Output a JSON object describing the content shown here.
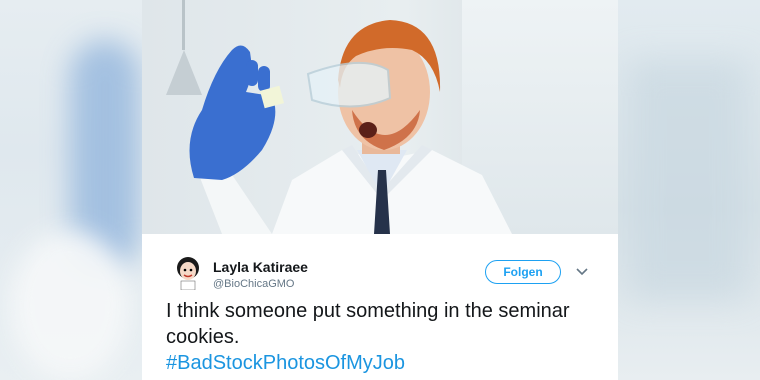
{
  "tweet": {
    "author_name": "Layla Katiraee",
    "author_handle": "@BioChicaGMO",
    "follow_label": "Folgen",
    "text": "I think someone put something in the seminar cookies.",
    "hashtag": "#BadStockPhotosOfMyJob"
  },
  "icons": {
    "more": "chevron-down-icon",
    "avatar": "avatar-cartoon"
  },
  "colors": {
    "accent": "#1da1f2",
    "hashtag": "#1b95e0",
    "text": "#14171a",
    "muted": "#657786"
  }
}
